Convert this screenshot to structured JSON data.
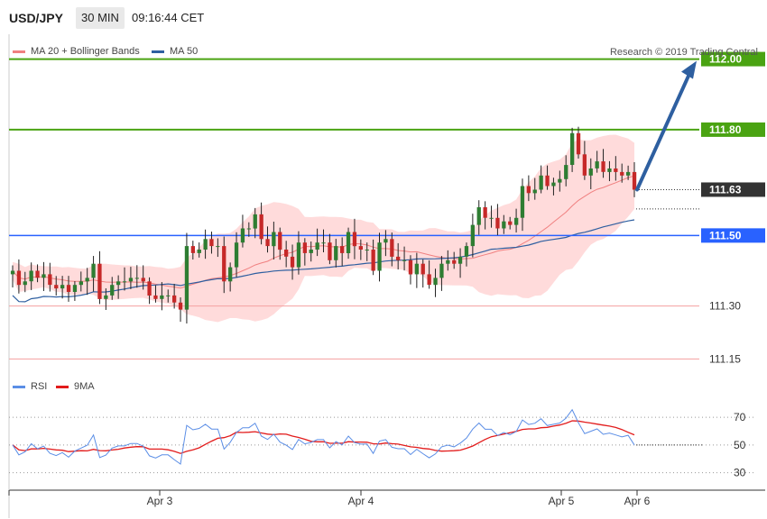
{
  "header": {
    "symbol": "USD/JPY",
    "timeframe": "30 MIN",
    "time": "09:16:44 CET"
  },
  "legend_main": [
    {
      "label": "MA 20 + Bollinger Bands",
      "color": "#f08080"
    },
    {
      "label": "MA 50",
      "color": "#2e5fa0"
    }
  ],
  "legend_rsi": [
    {
      "label": "RSI",
      "color": "#5b8ee6"
    },
    {
      "label": "9MA",
      "color": "#e21b1b"
    }
  ],
  "credit": "Research © 2019 Trading Central",
  "colors": {
    "up": "#2e7d32",
    "down": "#c62828",
    "band": "#ffd5d5",
    "level_green": "#4aa312",
    "level_blue": "#2962ff",
    "level_red": "#f4a0a0",
    "arrow": "#2e5fa0",
    "rsi": "#5b8ee6",
    "rsi_ma": "#e21b1b"
  },
  "chart_data": [
    {
      "type": "candlestick",
      "title": "USD/JPY 30 MIN",
      "x_ticks": [
        "Apr 3",
        "Apr 4",
        "Apr 5",
        "Apr 6"
      ],
      "ylim": [
        111.1,
        112.05
      ],
      "levels": [
        {
          "value": 112.0,
          "label": "112.00",
          "style": "resistance"
        },
        {
          "value": 111.8,
          "label": "111.80",
          "style": "resistance"
        },
        {
          "value": 111.63,
          "label": "111.63",
          "style": "last"
        },
        {
          "value": 111.5,
          "label": "111.50",
          "style": "pivot"
        },
        {
          "value": 111.3,
          "label": "111.30",
          "style": "support"
        },
        {
          "value": 111.15,
          "label": "111.15",
          "style": "support"
        }
      ],
      "projection": {
        "from": 111.63,
        "to": 112.0
      },
      "series": [
        {
          "name": "Close",
          "values": [
            111.4,
            111.36,
            111.37,
            111.4,
            111.38,
            111.39,
            111.36,
            111.35,
            111.36,
            111.34,
            111.36,
            111.37,
            111.38,
            111.42,
            111.32,
            111.33,
            111.36,
            111.37,
            111.37,
            111.38,
            111.38,
            111.37,
            111.33,
            111.32,
            111.33,
            111.33,
            111.31,
            111.29,
            111.47,
            111.45,
            111.46,
            111.49,
            111.47,
            111.47,
            111.37,
            111.41,
            111.48,
            111.52,
            111.52,
            111.56,
            111.49,
            111.47,
            111.51,
            111.46,
            111.44,
            111.41,
            111.48,
            111.45,
            111.46,
            111.48,
            111.48,
            111.43,
            111.47,
            111.45,
            111.51,
            111.47,
            111.46,
            111.46,
            111.4,
            111.48,
            111.49,
            111.44,
            111.43,
            111.43,
            111.39,
            111.42,
            111.39,
            111.36,
            111.38,
            111.42,
            111.43,
            111.42,
            111.44,
            111.47,
            111.53,
            111.58,
            111.55,
            111.55,
            111.52,
            111.54,
            111.53,
            111.55,
            111.64,
            111.62,
            111.63,
            111.67,
            111.64,
            111.65,
            111.66,
            111.7,
            111.79,
            111.73,
            111.67,
            111.69,
            111.71,
            111.68,
            111.69,
            111.68,
            111.67,
            111.68,
            111.63
          ]
        }
      ]
    },
    {
      "type": "line",
      "title": "RSI",
      "ylim": [
        20,
        85
      ],
      "y_ticks": [
        30,
        50,
        70
      ],
      "x_ticks": [
        "Apr 3",
        "Apr 4",
        "Apr 5",
        "Apr 6"
      ]
    }
  ]
}
